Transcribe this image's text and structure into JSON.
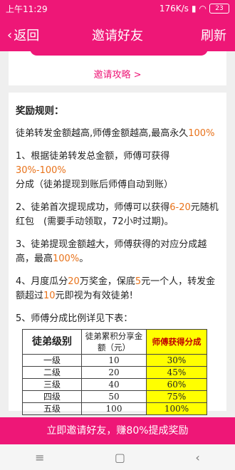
{
  "status": {
    "time": "上午11:29",
    "speed": "176K/s",
    "battery": "23"
  },
  "nav": {
    "back_label": "返回",
    "title": "邀请好友",
    "refresh_label": "刷新"
  },
  "guide_link": "邀请攻略 >",
  "rules": {
    "heading": "奖励规则：",
    "intro_text": "徒弟转发金额越高,师傅金额越高,最高永久",
    "intro_pct": "100%",
    "r1_a": "1、根据徒弟转发总金额，师傅可获得",
    "r1_pct": "30%-100%",
    "r1_b": "分成（徒弟提现到账后师傅自动到账）",
    "r2_a": "2、徒弟首次提现成功，师傅可以获得",
    "r2_range": "6-20",
    "r2_b": "元随机红包　(需要手动领取，72小时过期)。",
    "r3_a": "3、徒弟提现金额越大，师傅获得的对应分成越　高，最高",
    "r3_pct": "100%",
    "r3_b": "。",
    "r4_a": "4、月度瓜分",
    "r4_n1": "20",
    "r4_b": "万奖金，保底",
    "r4_n2": "5",
    "r4_c": "元一个人，转发金　额超过",
    "r4_n3": "10",
    "r4_d": "元即视为有效徒弟!",
    "r5": "5、师傅分成比例详见下表："
  },
  "table": {
    "headers": [
      "徒弟级别",
      "徒弟累积分享金额（元）",
      "师傅获得分成"
    ],
    "rows": [
      [
        "一级",
        "10",
        "30%"
      ],
      [
        "二级",
        "20",
        "45%"
      ],
      [
        "三级",
        "40",
        "60%"
      ],
      [
        "四级",
        "50",
        "75%"
      ],
      [
        "五级",
        "100",
        "100%"
      ]
    ]
  },
  "cta_label": "立即邀请好友，赚80%提成奖励",
  "colors": {
    "brand": "#ee1777",
    "highlight": "#e8721a",
    "table_highlight": "#ffff00"
  }
}
